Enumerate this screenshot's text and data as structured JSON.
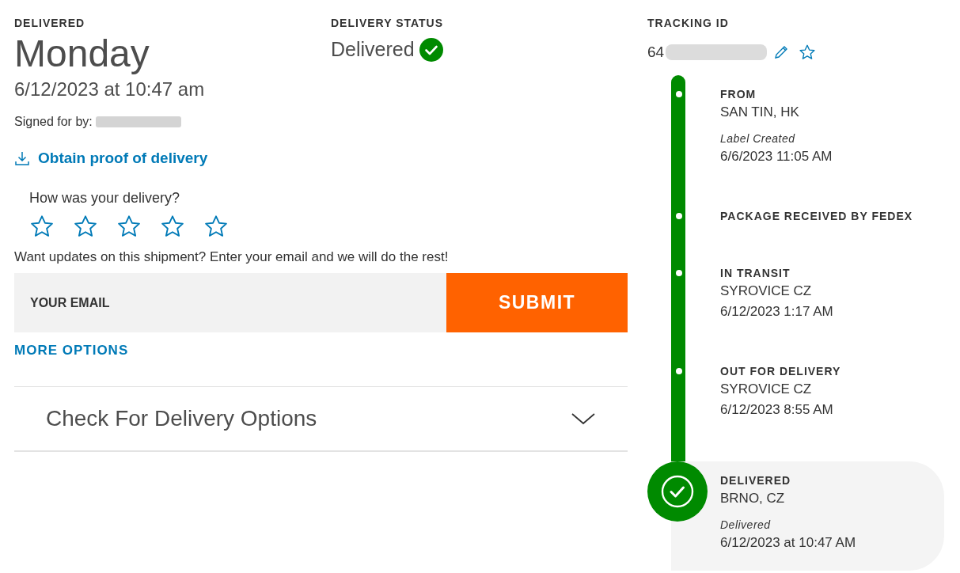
{
  "delivered": {
    "label": "DELIVERED",
    "day": "Monday",
    "datetime": "6/12/2023 at 10:47 am",
    "signed_for_label": "Signed for by:",
    "proof_link": "Obtain proof of delivery"
  },
  "delivery_status": {
    "label": "DELIVERY STATUS",
    "value": "Delivered"
  },
  "rating": {
    "question": "How was your delivery?",
    "stars": 0
  },
  "updates": {
    "prompt": "Want updates on this shipment? Enter your email and we will do the rest!",
    "placeholder": "YOUR EMAIL",
    "submit": "SUBMIT",
    "more_options": "MORE OPTIONS"
  },
  "accordion": {
    "title": "Check For Delivery Options",
    "expanded": false
  },
  "tracking": {
    "label": "TRACKING ID",
    "id_visible": "64"
  },
  "timeline": [
    {
      "kind": "dot",
      "title": "FROM",
      "location": "SAN TIN, HK",
      "status": "Label Created",
      "date": "6/6/2023 11:05 AM"
    },
    {
      "kind": "dot",
      "title": "PACKAGE RECEIVED BY FEDEX"
    },
    {
      "kind": "dot",
      "title": "IN TRANSIT",
      "location": "SYROVICE CZ",
      "date": "6/12/2023 1:17 AM"
    },
    {
      "kind": "dot",
      "title": "OUT FOR DELIVERY",
      "location": "SYROVICE CZ",
      "date": "6/12/2023 8:55 AM"
    },
    {
      "kind": "current",
      "title": "DELIVERED",
      "location": "BRNO, CZ",
      "status": "Delivered",
      "date": "6/12/2023 at 10:47 AM"
    }
  ]
}
